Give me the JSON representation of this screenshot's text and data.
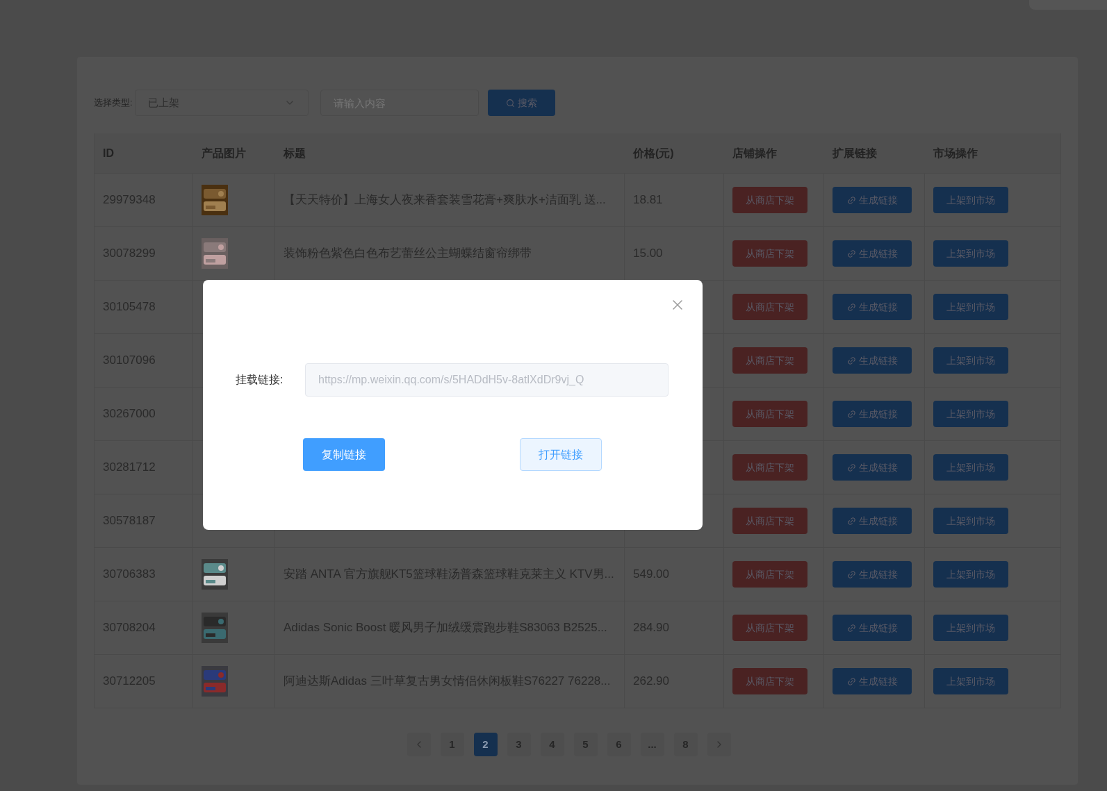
{
  "filter": {
    "label": "选择类型:",
    "select": {
      "value": "已上架"
    },
    "search": {
      "placeholder": "请输入内容"
    },
    "search_button": "搜索"
  },
  "table": {
    "columns": [
      "ID",
      "产品图片",
      "标题",
      "价格(元)",
      "店铺操作",
      "扩展链接",
      "市场操作"
    ],
    "rows": [
      {
        "id": "29979348",
        "title": "【天天特价】上海女人夜来香套装雪花膏+爽肤水+洁面乳 送...",
        "price": "18.81",
        "actions": [
          "从商店下架",
          "生成链接",
          "上架到市场"
        ]
      },
      {
        "id": "30078299",
        "title": "装饰粉色紫色白色布艺蕾丝公主蝴蝶结窗帘绑带",
        "price": "15.00",
        "actions": [
          "从商店下架",
          "生成链接",
          "上架到市场"
        ]
      },
      {
        "id": "30105478",
        "actions": [
          "从商店下架",
          "生成链接",
          "上架到市场"
        ]
      },
      {
        "id": "30107096",
        "actions": [
          "从商店下架",
          "生成链接",
          "上架到市场"
        ]
      },
      {
        "id": "30267000",
        "actions": [
          "从商店下架",
          "生成链接",
          "上架到市场"
        ]
      },
      {
        "id": "30281712",
        "actions": [
          "从商店下架",
          "生成链接",
          "上架到市场"
        ]
      },
      {
        "id": "30578187",
        "actions": [
          "从商店下架",
          "生成链接",
          "上架到市场"
        ]
      },
      {
        "id": "30706383",
        "title": "安踏 ANTA 官方旗舰KT5篮球鞋汤普森篮球鞋克莱主义 KTV男...",
        "price": "549.00",
        "actions": [
          "从商店下架",
          "生成链接",
          "上架到市场"
        ]
      },
      {
        "id": "30708204",
        "title": "Adidas Sonic Boost 暖风男子加绒缓震跑步鞋S83063 B2525...",
        "price": "284.90",
        "actions": [
          "从商店下架",
          "生成链接",
          "上架到市场"
        ]
      },
      {
        "id": "30712205",
        "title": "阿迪达斯Adidas 三叶草复古男女情侣休闲板鞋S76227 76228...",
        "price": "262.90",
        "actions": [
          "从商店下架",
          "生成链接",
          "上架到市场"
        ]
      }
    ]
  },
  "pagination": {
    "pages": [
      {
        "label": "1",
        "selected": false
      },
      {
        "label": "2",
        "selected": true
      },
      {
        "label": "3",
        "selected": false
      },
      {
        "label": "4",
        "selected": false
      },
      {
        "label": "5",
        "selected": false
      },
      {
        "label": "6",
        "selected": false
      },
      {
        "label": "...",
        "selected": false
      },
      {
        "label": "8",
        "selected": false
      }
    ]
  },
  "dialog": {
    "label": "挂载链接:",
    "link": {
      "value": "https://mp.weixin.qq.com/s/5HADdH5v-8atlXdDr9vj_Q",
      "disabled": true
    },
    "buttons": [
      {
        "label": "复制链接",
        "kind": "primary"
      },
      {
        "label": "打开链接",
        "kind": "plain"
      }
    ]
  }
}
